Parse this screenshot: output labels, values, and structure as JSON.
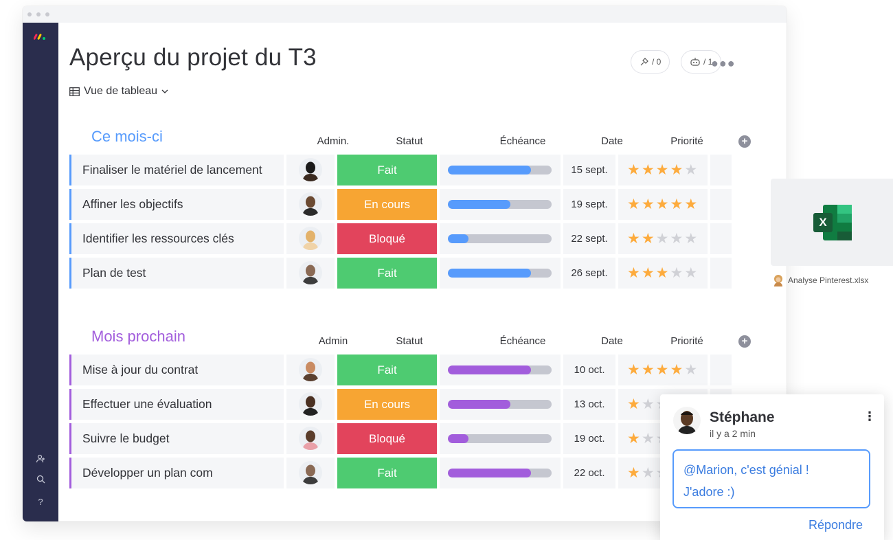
{
  "page": {
    "title": "Aperçu du projet du T3",
    "view_label": "Vue de tableau",
    "header_pills": [
      {
        "icon": "integration-icon",
        "count": "/ 0"
      },
      {
        "icon": "robot-icon",
        "count": "/ 1"
      }
    ]
  },
  "colors": {
    "sidebar": "#2a2d4d",
    "done": "#4ecb71",
    "working": "#f7a533",
    "stuck": "#e2445c",
    "group1": "#579bfc",
    "group2": "#a25ddc",
    "star": "#fdab3d"
  },
  "groups": [
    {
      "title": "Ce mois-ci",
      "color": "#579bfc",
      "columns": [
        "Admin.",
        "Statut",
        "Échéance",
        "Date",
        "Priorité"
      ],
      "rows": [
        {
          "name": "Finaliser le matériel de lancement",
          "status": "Fait",
          "status_color": "#4ecb71",
          "progress": 0.8,
          "date": "15 sept.",
          "priority": 4
        },
        {
          "name": "Affiner les objectifs",
          "status": "En cours",
          "status_color": "#f7a533",
          "progress": 0.6,
          "date": "19 sept.",
          "priority": 5
        },
        {
          "name": "Identifier les ressources clés",
          "status": "Bloqué",
          "status_color": "#e2445c",
          "progress": 0.2,
          "date": "22 sept.",
          "priority": 2
        },
        {
          "name": "Plan de test",
          "status": "Fait",
          "status_color": "#4ecb71",
          "progress": 0.8,
          "date": "26 sept.",
          "priority": 3
        }
      ]
    },
    {
      "title": "Mois prochain",
      "color": "#a25ddc",
      "columns": [
        "Admin",
        "Statut",
        "Échéance",
        "Date",
        "Priorité"
      ],
      "rows": [
        {
          "name": "Mise à jour du contrat",
          "status": "Fait",
          "status_color": "#4ecb71",
          "progress": 0.8,
          "date": "10 oct.",
          "priority": 4
        },
        {
          "name": "Effectuer une évaluation",
          "status": "En cours",
          "status_color": "#f7a533",
          "progress": 0.6,
          "date": "13 oct.",
          "priority": 1
        },
        {
          "name": "Suivre le budget",
          "status": "Bloqué",
          "status_color": "#e2445c",
          "progress": 0.2,
          "date": "19 oct.",
          "priority": 1
        },
        {
          "name": "Développer un plan com",
          "status": "Fait",
          "status_color": "#4ecb71",
          "progress": 0.8,
          "date": "22 oct.",
          "priority": 1
        }
      ]
    }
  ],
  "attachment": {
    "file_name": "Analyse Pinterest.xlsx",
    "icon": "excel-icon"
  },
  "comment": {
    "author": "Stéphane",
    "time": "il y a 2 min",
    "text_line1": "@Marion, c'est génial !",
    "text_line2": "J'adore :)",
    "reply_label": "Répondre"
  }
}
